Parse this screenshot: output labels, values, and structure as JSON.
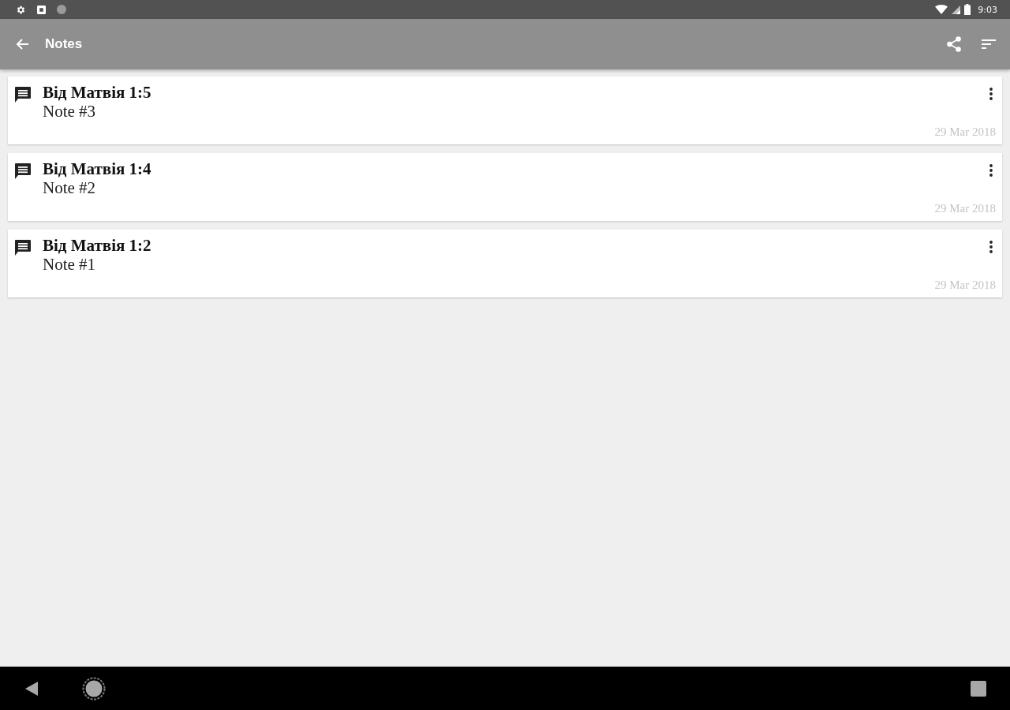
{
  "status_bar": {
    "time": "9:03"
  },
  "app_bar": {
    "title": "Notes"
  },
  "notes": [
    {
      "title": "Від Матвія 1:5",
      "text": "Note #3",
      "date": "29 Mar 2018"
    },
    {
      "title": "Від Матвія 1:4",
      "text": "Note #2",
      "date": "29 Mar 2018"
    },
    {
      "title": "Від Матвія 1:2",
      "text": "Note #1",
      "date": "29 Mar 2018"
    }
  ]
}
